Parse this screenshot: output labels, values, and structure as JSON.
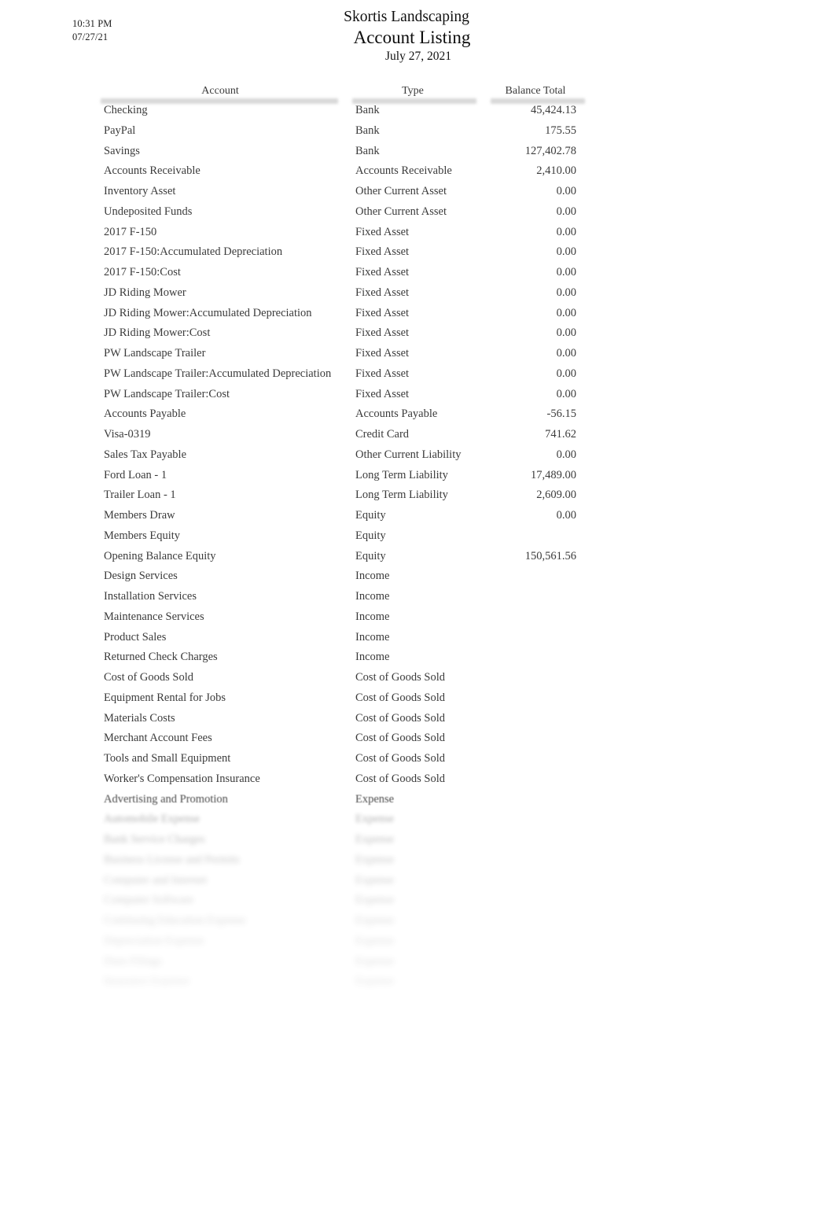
{
  "stamp": {
    "time": "10:31 PM",
    "date": "07/27/21"
  },
  "header": {
    "company": "Skortis Landscaping",
    "report_title": "Account Listing",
    "report_date": "July 27, 2021"
  },
  "table": {
    "columns": {
      "account": "Account",
      "type": "Type",
      "balance": "Balance Total"
    },
    "rows": [
      {
        "account": "Checking",
        "type": "Bank",
        "balance": "45,424.13",
        "fade": 0
      },
      {
        "account": "PayPal",
        "type": "Bank",
        "balance": "175.55",
        "fade": 0
      },
      {
        "account": "Savings",
        "type": "Bank",
        "balance": "127,402.78",
        "fade": 0
      },
      {
        "account": "Accounts Receivable",
        "type": "Accounts Receivable",
        "balance": "2,410.00",
        "fade": 0
      },
      {
        "account": "Inventory Asset",
        "type": "Other Current Asset",
        "balance": "0.00",
        "fade": 0
      },
      {
        "account": "Undeposited Funds",
        "type": "Other Current Asset",
        "balance": "0.00",
        "fade": 0
      },
      {
        "account": "2017 F-150",
        "type": "Fixed Asset",
        "balance": "0.00",
        "fade": 0
      },
      {
        "account": "2017 F-150:Accumulated Depreciation",
        "type": "Fixed Asset",
        "balance": "0.00",
        "fade": 0
      },
      {
        "account": "2017 F-150:Cost",
        "type": "Fixed Asset",
        "balance": "0.00",
        "fade": 0
      },
      {
        "account": "JD Riding Mower",
        "type": "Fixed Asset",
        "balance": "0.00",
        "fade": 0
      },
      {
        "account": "JD Riding Mower:Accumulated Depreciation",
        "type": "Fixed Asset",
        "balance": "0.00",
        "fade": 0
      },
      {
        "account": "JD Riding Mower:Cost",
        "type": "Fixed Asset",
        "balance": "0.00",
        "fade": 0
      },
      {
        "account": "PW Landscape Trailer",
        "type": "Fixed Asset",
        "balance": "0.00",
        "fade": 0
      },
      {
        "account": "PW Landscape Trailer:Accumulated Depreciation",
        "type": "Fixed Asset",
        "balance": "0.00",
        "fade": 0
      },
      {
        "account": "PW Landscape Trailer:Cost",
        "type": "Fixed Asset",
        "balance": "0.00",
        "fade": 0
      },
      {
        "account": "Accounts Payable",
        "type": "Accounts Payable",
        "balance": "-56.15",
        "fade": 0
      },
      {
        "account": "Visa-0319",
        "type": "Credit Card",
        "balance": "741.62",
        "fade": 0
      },
      {
        "account": "Sales Tax Payable",
        "type": "Other Current Liability",
        "balance": "0.00",
        "fade": 0
      },
      {
        "account": "Ford Loan - 1",
        "type": "Long Term Liability",
        "balance": "17,489.00",
        "fade": 0
      },
      {
        "account": "Trailer Loan - 1",
        "type": "Long Term Liability",
        "balance": "2,609.00",
        "fade": 0
      },
      {
        "account": "Members Draw",
        "type": "Equity",
        "balance": "0.00",
        "fade": 0
      },
      {
        "account": "Members Equity",
        "type": "Equity",
        "balance": "",
        "fade": 0
      },
      {
        "account": "Opening Balance Equity",
        "type": "Equity",
        "balance": "150,561.56",
        "fade": 0
      },
      {
        "account": "Design Services",
        "type": "Income",
        "balance": "",
        "fade": 0
      },
      {
        "account": "Installation Services",
        "type": "Income",
        "balance": "",
        "fade": 0
      },
      {
        "account": "Maintenance Services",
        "type": "Income",
        "balance": "",
        "fade": 0
      },
      {
        "account": "Product Sales",
        "type": "Income",
        "balance": "",
        "fade": 0
      },
      {
        "account": "Returned Check Charges",
        "type": "Income",
        "balance": "",
        "fade": 0
      },
      {
        "account": "Cost of Goods Sold",
        "type": "Cost of Goods Sold",
        "balance": "",
        "fade": 0
      },
      {
        "account": "Equipment Rental for Jobs",
        "type": "Cost of Goods Sold",
        "balance": "",
        "fade": 0
      },
      {
        "account": "Materials Costs",
        "type": "Cost of Goods Sold",
        "balance": "",
        "fade": 0
      },
      {
        "account": "Merchant Account Fees",
        "type": "Cost of Goods Sold",
        "balance": "",
        "fade": 0
      },
      {
        "account": "Tools and Small Equipment",
        "type": "Cost of Goods Sold",
        "balance": "",
        "fade": 0
      },
      {
        "account": "Worker's Compensation Insurance",
        "type": "Cost of Goods Sold",
        "balance": "",
        "fade": 0
      },
      {
        "account": "Advertising and Promotion",
        "type": "Expense",
        "balance": "",
        "fade": 1
      },
      {
        "account": "Automobile Expense",
        "type": "Expense",
        "balance": "",
        "fade": 3
      },
      {
        "account": "Bank Service Charges",
        "type": "Expense",
        "balance": "",
        "fade": 4
      },
      {
        "account": "Business License and Permits",
        "type": "Expense",
        "balance": "",
        "fade": 5
      },
      {
        "account": "Computer and Internet",
        "type": "Expense",
        "balance": "",
        "fade": 6
      },
      {
        "account": "Computer Software",
        "type": "Expense",
        "balance": "",
        "fade": 7
      },
      {
        "account": "Continuing Education Expense",
        "type": "Expense",
        "balance": "",
        "fade": 8
      },
      {
        "account": "Depreciation Expense",
        "type": "Expense",
        "balance": "",
        "fade": 9
      },
      {
        "account": "Dues Filings",
        "type": "Expense",
        "balance": "",
        "fade": 9
      },
      {
        "account": "Insurance Expense",
        "type": "Expense",
        "balance": "",
        "fade": 10
      }
    ]
  }
}
